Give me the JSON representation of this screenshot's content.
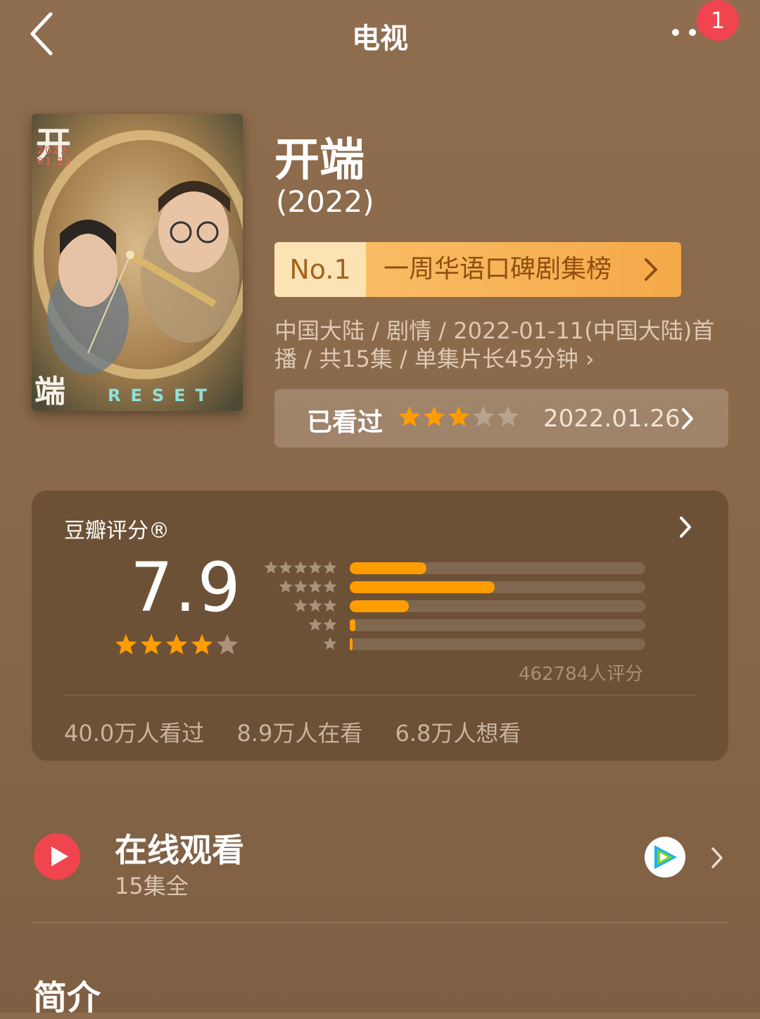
{
  "header": {
    "title": "电视",
    "badge_count": "1"
  },
  "show": {
    "name": "开端",
    "year": "(2022)",
    "rank": {
      "number": "No.1",
      "label": "一周华语口碑剧集榜"
    },
    "meta": "中国大陆 / 剧情 / 2022-01-11(中国大陆)首播 / 共15集 / 单集片长45分钟",
    "watched": {
      "label": "已看过",
      "user_stars": 3,
      "date": "2022.01.26"
    }
  },
  "poster": {
    "title_top": "开",
    "date": "2022 01.11",
    "title_bottom": "端",
    "reset": "RESET"
  },
  "rating": {
    "header": "豆瓣评分®",
    "score": "7.9",
    "stars": 4,
    "distribution": [
      0.26,
      0.49,
      0.2,
      0.02,
      0.005
    ],
    "count": "462784人评分",
    "stats": {
      "seen": "40.0万人看过",
      "watching": "8.9万人在看",
      "want": "6.8万人想看"
    }
  },
  "online": {
    "title": "在线观看",
    "subtitle": "15集全"
  },
  "intro": {
    "title": "简介"
  },
  "colors": {
    "accent": "#ff9d00",
    "badge": "#f0454f"
  }
}
